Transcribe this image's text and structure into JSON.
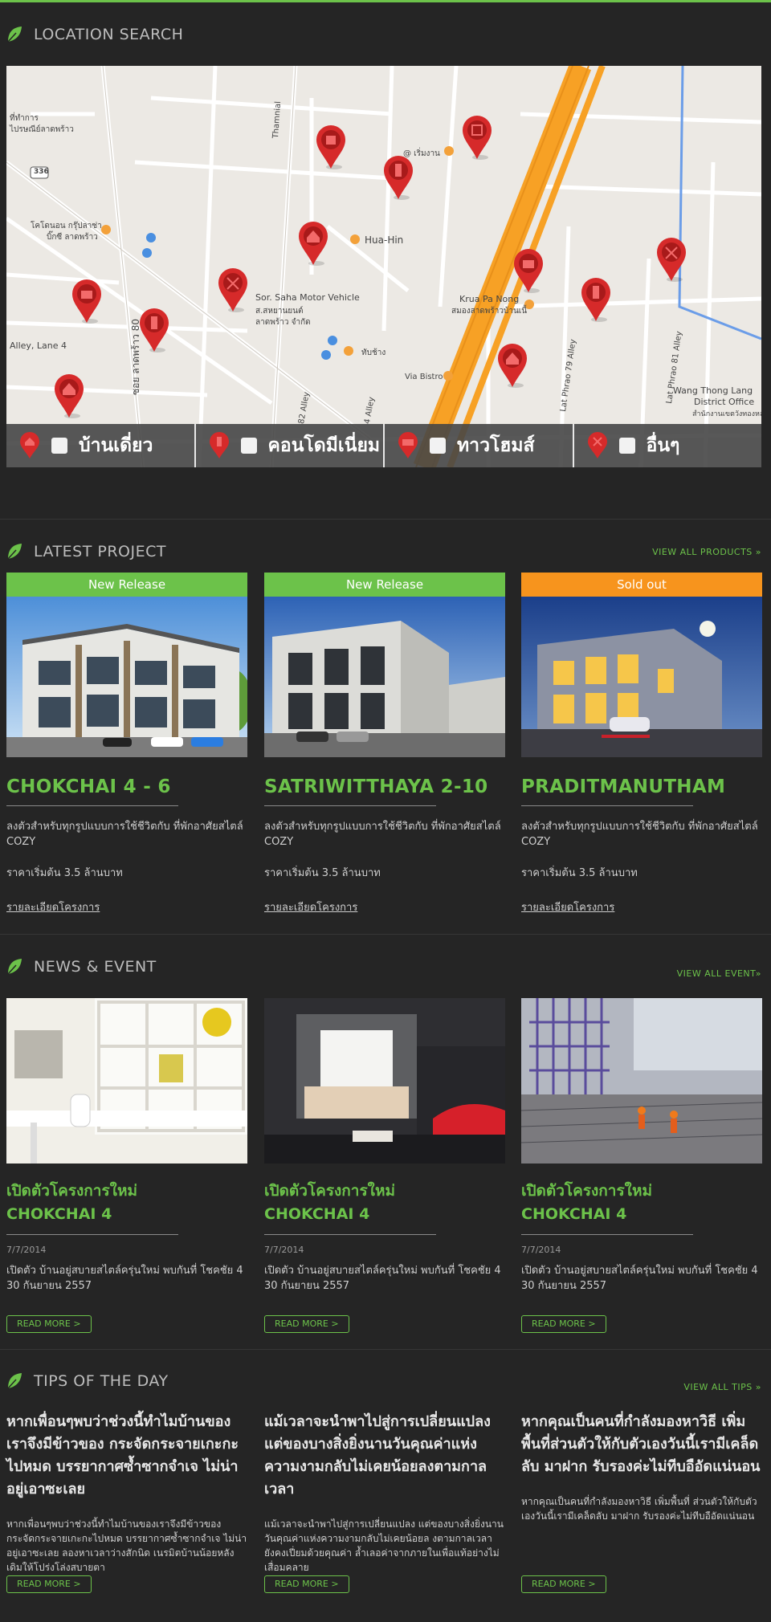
{
  "location": {
    "title": "LOCATION SEARCH",
    "map_labels": {
      "l1": "ที่ทำการ",
      "l2": "ไปรษณีย์ลาดพร้าว",
      "l3": "336",
      "l4": "@ เริ่มงาน",
      "l5": "Thamnial",
      "l6": "โคโดนอน กรุ๊ปลาซ่า",
      "l7": "บิ๊กซี ลาดพร้าว",
      "l8": "Hua-Hin",
      "l9": "Sor. Saha Motor Vehicle",
      "l10": "ส.สหยานยนต์",
      "l11": "ลาดพร้าว จำกัด",
      "l12": "Krua Pa Nong",
      "l13": "สมองสาดพร้าวบ้านเนื้",
      "l14": "Alley, Lane 4",
      "l15": "ซอย ลาดพร้าว 80",
      "l16": "ทับช้าง",
      "l17": "Via Bistro",
      "l18": "Lat Phrao 79 Alley",
      "l19": "Lat Phrao 81 Alley",
      "l20": "Wang Thong Lang",
      "l21": "District Office",
      "l22": "สำนักงานเขตวังทองหลาง",
      "l23": "82 Alley",
      "l24": "4 Alley"
    },
    "filters": [
      {
        "label": "บ้านเดี่ยว",
        "icon": "house-icon"
      },
      {
        "label": "คอนโดมีเนี่ยม",
        "icon": "condo-icon"
      },
      {
        "label": "ทาวโฮมส์",
        "icon": "townhome-icon"
      },
      {
        "label": "อื่นๆ",
        "icon": "other-icon"
      }
    ]
  },
  "projects": {
    "title": "LATEST PROJECT",
    "view_all": "VIEW ALL PRODUCTS »",
    "items": [
      {
        "badge": "New Release",
        "badge_color": "#6cc24a",
        "name": "CHOKCHAI 4 - 6",
        "desc": "ลงตัวสำหรับทุกรูปแบบการใช้ชีวิตกับ ที่พักอาศัยสไตล์ COZY",
        "price": "ราคาเริ่มต้น 3.5 ล้านบาท",
        "link": "รายละเอียดโครงการ"
      },
      {
        "badge": "New Release",
        "badge_color": "#6cc24a",
        "name": "SATRIWITTHAYA 2-10",
        "desc": "ลงตัวสำหรับทุกรูปแบบการใช้ชีวิตกับ ที่พักอาศัยสไตล์ COZY",
        "price": "ราคาเริ่มต้น 3.5 ล้านบาท",
        "link": "รายละเอียดโครงการ"
      },
      {
        "badge": "Sold out",
        "badge_color": "#f7941d",
        "name": "PRADITMANUTHAM",
        "desc": "ลงตัวสำหรับทุกรูปแบบการใช้ชีวิตกับ ที่พักอาศัยสไตล์ COZY",
        "price": "ราคาเริ่มต้น 3.5 ล้านบาท",
        "link": "รายละเอียดโครงการ"
      }
    ]
  },
  "news": {
    "title": "NEWS & EVENT",
    "view_all": "VIEW ALL EVENT»",
    "items": [
      {
        "title1": "เปิดตัวโครงการใหม่",
        "title2": "CHOKCHAI 4",
        "date": "7/7/2014",
        "text": "เปิดตัว บ้านอยู่สบายสไตล์ครุ่นใหม่ พบกันที่ โชคชัย 4 30 กันยายน 2557",
        "read_more": "READ MORE  >"
      },
      {
        "title1": "เปิดตัวโครงการใหม่",
        "title2": "CHOKCHAI 4",
        "date": "7/7/2014",
        "text": "เปิดตัว บ้านอยู่สบายสไตล์ครุ่นใหม่ พบกันที่ โชคชัย 4 30 กันยายน 2557",
        "read_more": "READ MORE  >"
      },
      {
        "title1": "เปิดตัวโครงการใหม่",
        "title2": "CHOKCHAI 4",
        "date": "7/7/2014",
        "text": "เปิดตัว บ้านอยู่สบายสไตล์ครุ่นใหม่ พบกันที่ โชคชัย 4 30 กันยายน 2557",
        "read_more": "READ MORE  >"
      }
    ]
  },
  "tips": {
    "title": "TIPS OF THE DAY",
    "view_all": "VIEW ALL TIPS  »",
    "items": [
      {
        "title": "หากเพื่อนๆพบว่าช่วงนี้ทำไมบ้านของเราจึงมีข้าวของ กระจัดกระจายเกะกะไปหมด บรรยากาศซ้ำซากจำเจ ไม่น่าอยู่เอาซะเลย",
        "text": "หากเพื่อนๆพบว่าช่วงนี้ทำไมบ้านของเราจึงมีข้าวของ กระจัดกระจายเกะกะไปหมด บรรยากาศซ้ำซากจำเจ ไม่น่าอยู่เอาซะเลย ลองหาเวลาว่างสักนิด เนรมิตบ้านน้อยหลังเดิมให้โปร่งโล่งสบายตา",
        "read_more": "READ MORE  >"
      },
      {
        "title": "แม้เวลาจะนำพาไปสู่การเปลี่ยนแปลง แต่ของบางสิ่งยิ่งนานวันคุณค่าแห่งความงามกลับไม่เคยน้อยลงตามกาลเวลา",
        "text": "แม้เวลาจะนำพาไปสู่การเปลี่ยนแปลง แต่ของบางสิ่งยิ่งนานวันคุณค่าแห่งความงามกลับไม่เคยน้อยล งตามกาลเวลา ยังคงเปี่ยมด้วยคุณค่า ล้ำเลอค่าจากภายในเพื่อแท้อย่างไม่เสื่อมคลาย",
        "read_more": "READ MORE  >"
      },
      {
        "title": "หากคุณเป็นคนที่กำลังมองหาวิธี เพิ่มพื้นที่ส่วนตัวให้กับตัวเองวันนี้เรามีเคล็ดลับ มาฝาก รับรองค่ะไม่ทีบอือัดแน่นอน",
        "text": "หากคุณเป็นคนที่กำลังมองหาวิธี เพิ่มพื้นที่ ส่วนตัวให้กับตัวเองวันนี้เรามีเคล็ดลับ มาฝาก รับรองค่ะไม่ทีบอือัดแน่นอน",
        "read_more": "READ MORE  >"
      }
    ]
  },
  "colors": {
    "accent": "#6cc24a",
    "sold_out": "#f7941d",
    "pin": "#d62a2a",
    "background": "#252525"
  }
}
